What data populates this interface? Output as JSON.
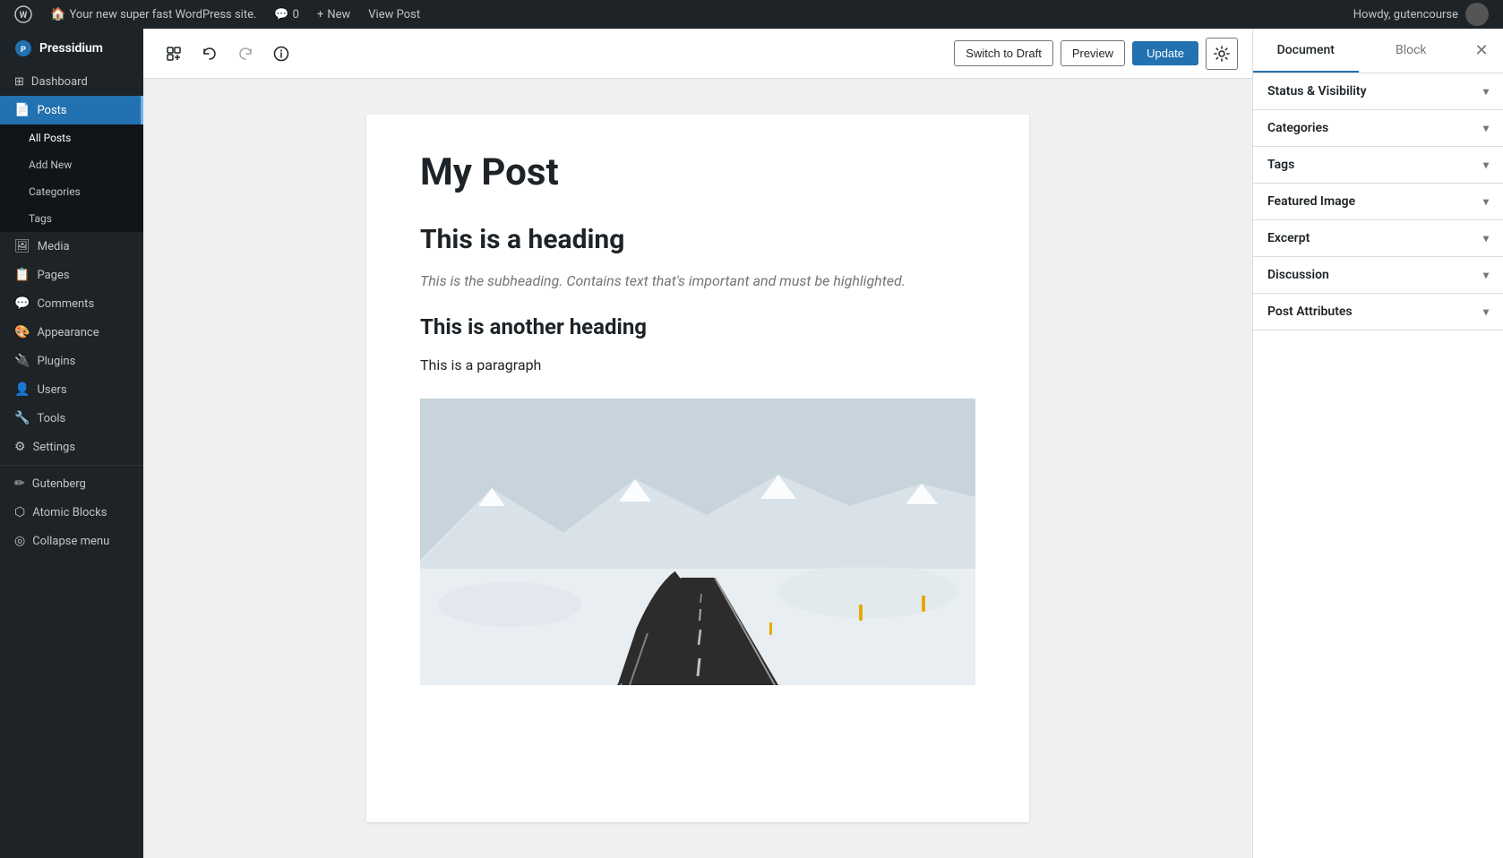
{
  "adminBar": {
    "siteName": "Your new super fast WordPress site.",
    "newLabel": "New",
    "viewPostLabel": "View Post",
    "commentsCount": "0",
    "howdy": "Howdy, gutencourse"
  },
  "sidebar": {
    "siteName": "Pressidium",
    "items": [
      {
        "id": "dashboard",
        "label": "Dashboard",
        "icon": "⊞"
      },
      {
        "id": "posts",
        "label": "Posts",
        "icon": "📄",
        "active": true
      },
      {
        "id": "all-posts",
        "label": "All Posts",
        "sub": true
      },
      {
        "id": "add-new",
        "label": "Add New",
        "sub": true
      },
      {
        "id": "categories",
        "label": "Categories",
        "sub": true
      },
      {
        "id": "tags",
        "label": "Tags",
        "sub": true
      },
      {
        "id": "media",
        "label": "Media",
        "icon": "🖼"
      },
      {
        "id": "pages",
        "label": "Pages",
        "icon": "📋"
      },
      {
        "id": "comments",
        "label": "Comments",
        "icon": "💬"
      },
      {
        "id": "appearance",
        "label": "Appearance",
        "icon": "🎨"
      },
      {
        "id": "plugins",
        "label": "Plugins",
        "icon": "🔌"
      },
      {
        "id": "users",
        "label": "Users",
        "icon": "👤"
      },
      {
        "id": "tools",
        "label": "Tools",
        "icon": "🔧"
      },
      {
        "id": "settings",
        "label": "Settings",
        "icon": "⚙"
      },
      {
        "id": "gutenberg",
        "label": "Gutenberg",
        "icon": "✏"
      },
      {
        "id": "atomic-blocks",
        "label": "Atomic Blocks",
        "icon": "⬡"
      },
      {
        "id": "collapse",
        "label": "Collapse menu",
        "icon": "◎"
      }
    ]
  },
  "toolbar": {
    "addBlockTitle": "Add block",
    "undoTitle": "Undo",
    "redoTitle": "Redo",
    "infoTitle": "Information",
    "switchToDraftLabel": "Switch to Draft",
    "previewLabel": "Preview",
    "updateLabel": "Update",
    "settingsLabel": "Settings"
  },
  "post": {
    "title": "My Post",
    "heading1": "This is a heading",
    "subheading": "This is the subheading. Contains text that's important and must be highlighted.",
    "heading2": "This is another heading",
    "paragraph": "This is a paragraph"
  },
  "rightPanel": {
    "documentTab": "Document",
    "blockTab": "Block",
    "sections": [
      {
        "id": "status-visibility",
        "label": "Status & Visibility"
      },
      {
        "id": "categories",
        "label": "Categories"
      },
      {
        "id": "tags",
        "label": "Tags"
      },
      {
        "id": "featured-image",
        "label": "Featured Image"
      },
      {
        "id": "excerpt",
        "label": "Excerpt"
      },
      {
        "id": "discussion",
        "label": "Discussion"
      },
      {
        "id": "post-attributes",
        "label": "Post Attributes"
      }
    ]
  }
}
